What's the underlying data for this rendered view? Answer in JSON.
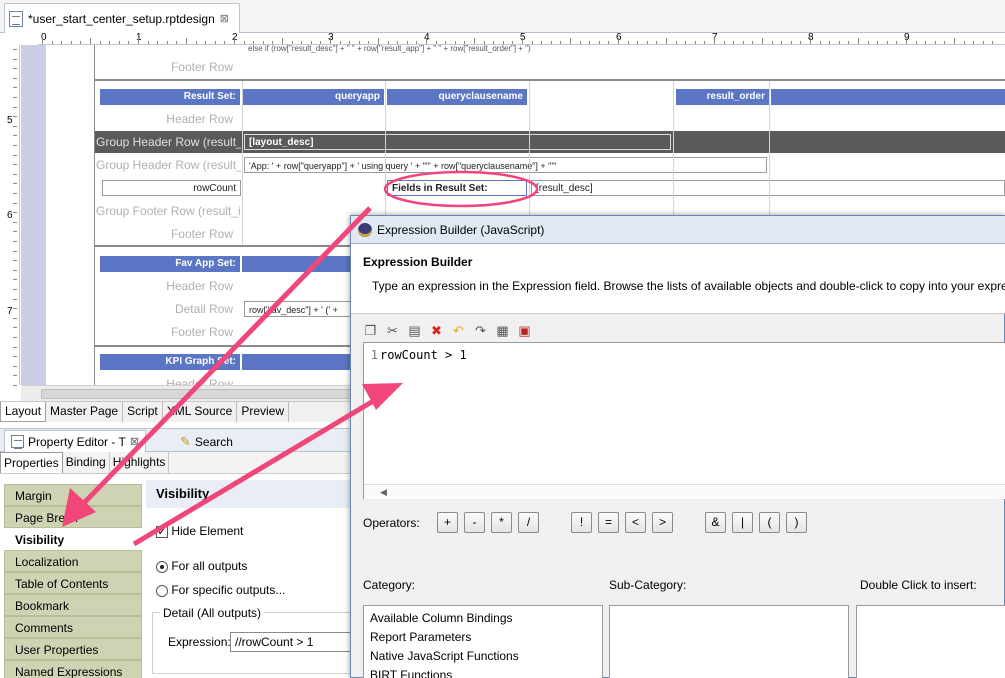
{
  "editor_tab": {
    "title": "*user_start_center_setup.rptdesign",
    "close": "⊠"
  },
  "ruler": {
    "numbers": [
      "0",
      "1",
      "2",
      "3",
      "4",
      "5",
      "6",
      "7",
      "8",
      "9"
    ],
    "vertical_numbers": [
      "5",
      "6",
      "7"
    ]
  },
  "report": {
    "footer_row": "Footer Row",
    "result_set_label": "Result Set:",
    "result_set_cols": [
      "queryapp",
      "queryclausename",
      "result_order"
    ],
    "header_row": "Header Row",
    "group_header_row": "Group Header Row (result_id",
    "layout_desc": "[layout_desc]",
    "group_header_row2": "Group Header Row (result_id",
    "app_expr": "'App: ' + row[\"queryapp\"] + ' using query ' + \"'\" + row[\"queryclausename\"] + \"'\"",
    "rowcount": "rowCount",
    "fields_in_result_set": "Fields in Result Set:",
    "result_desc": "[result_desc]",
    "group_footer_row": "Group Footer Row (result_id",
    "footer_row2": "Footer Row",
    "fav_app_set": "Fav App Set:",
    "header_row2": "Header Row",
    "detail_row": "Detail Row",
    "fav_expr": "row[\"fav_desc\"] + ' (' +",
    "footer_row3": "Footer Row",
    "kpi_graph_set": "KPI Graph Set:",
    "header_row3": "Header Row",
    "top_row_text": "else if (row[\"result_desc\"] + \" \" + row[\"result_app\"] + \" \" + row[\"result_order\"] + \")"
  },
  "view_tabs": [
    "Layout",
    "Master Page",
    "Script",
    "XML Source",
    "Preview"
  ],
  "property_editor": {
    "title": "Property Editor - T",
    "search_tab": "Search",
    "subtabs": [
      "Properties",
      "Binding",
      "Highlights"
    ],
    "categories": [
      "Margin",
      "Page Break",
      "Visibility",
      "Localization",
      "Table of Contents",
      "Bookmark",
      "Comments",
      "User Properties",
      "Named Expressions"
    ],
    "selected_category": "Visibility",
    "panel_title": "Visibility",
    "hide_element": "Hide Element",
    "for_all_outputs": "For all outputs",
    "for_specific_outputs": "For specific outputs...",
    "detail_group": "Detail (All outputs)",
    "expression_label": "Expression:",
    "expression_value": "//rowCount > 1"
  },
  "dialog": {
    "title": "Expression Builder (JavaScript)",
    "heading": "Expression Builder",
    "description": "Type an expression in the Expression field. Browse the lists of available objects and double-click to copy into your express",
    "line_number": "1",
    "code": "rowCount > 1",
    "operators_label": "Operators:",
    "operators": [
      "+",
      "-",
      "*",
      "/",
      "!",
      "=",
      "<",
      ">",
      "&",
      "|",
      "(",
      ")"
    ],
    "category_label": "Category:",
    "subcategory_label": "Sub-Category:",
    "double_click_label": "Double Click to insert:",
    "categories": [
      "Available Column Bindings",
      "Report Parameters",
      "Native JavaScript Functions",
      "BIRT Functions"
    ]
  },
  "colors": {
    "annotation": "#f0467a",
    "header_bar": "#5b76c4",
    "margin_band": "#c9cde6",
    "category_bg": "#cdd3b3"
  }
}
